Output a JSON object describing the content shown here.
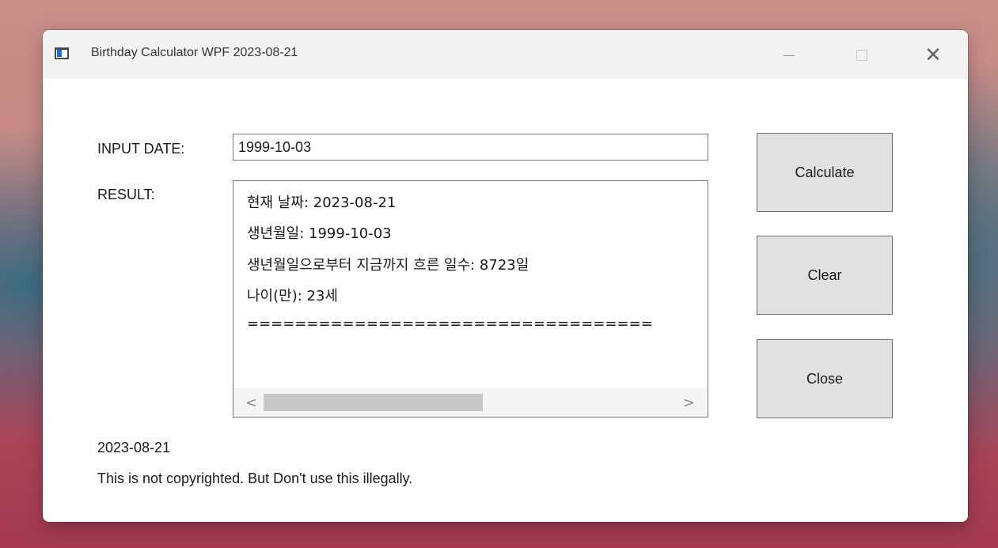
{
  "window": {
    "title": "Birthday Calculator WPF 2023-08-21",
    "minimize_glyph": "—",
    "close_glyph": "✕"
  },
  "form": {
    "input_label": "INPUT DATE:",
    "input_value": "1999-10-03",
    "result_label": "RESULT:",
    "result_lines": [
      "현재 날짜: 2023-08-21",
      "생년월일: 1999-10-03",
      "생년월일으로부터 지금까지 흐른 일수: 8723일",
      "나이(만): 23세",
      "=================================="
    ],
    "scroll_left": "<",
    "scroll_right": ">",
    "scroll_position": 0
  },
  "buttons": {
    "calculate": "Calculate",
    "clear": "Clear",
    "close": "Close"
  },
  "footer": {
    "date": "2023-08-21",
    "notice": "This is not copyrighted. But Don't use this illegally."
  }
}
